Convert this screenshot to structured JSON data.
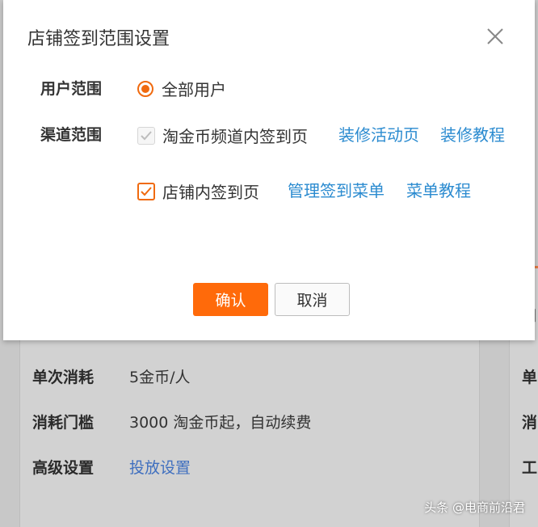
{
  "dialog": {
    "title": "店铺签到范围设置",
    "user_scope": {
      "label": "用户范围",
      "option": "全部用户"
    },
    "channel_scope": {
      "label": "渠道范围",
      "option1": "淘金币频道内签到页",
      "option1_link1": "装修活动页",
      "option1_link2": "装修教程",
      "option2": "店铺内签到页",
      "option2_link1": "管理签到菜单",
      "option2_link2": "菜单教程"
    },
    "confirm_label": "确认",
    "cancel_label": "取消"
  },
  "background": {
    "rows": [
      {
        "label": "单次消耗",
        "value": "5金币/人"
      },
      {
        "label": "消耗门槛",
        "value": "3000 淘金币起，自动续费"
      },
      {
        "label": "高级设置",
        "value": "投放设置"
      }
    ],
    "side_labels": [
      "单",
      "消",
      "工"
    ]
  },
  "watermark": "头条 @电商前沿君",
  "colors": {
    "accent": "#ff6a0a",
    "link": "#2b8bd0"
  }
}
